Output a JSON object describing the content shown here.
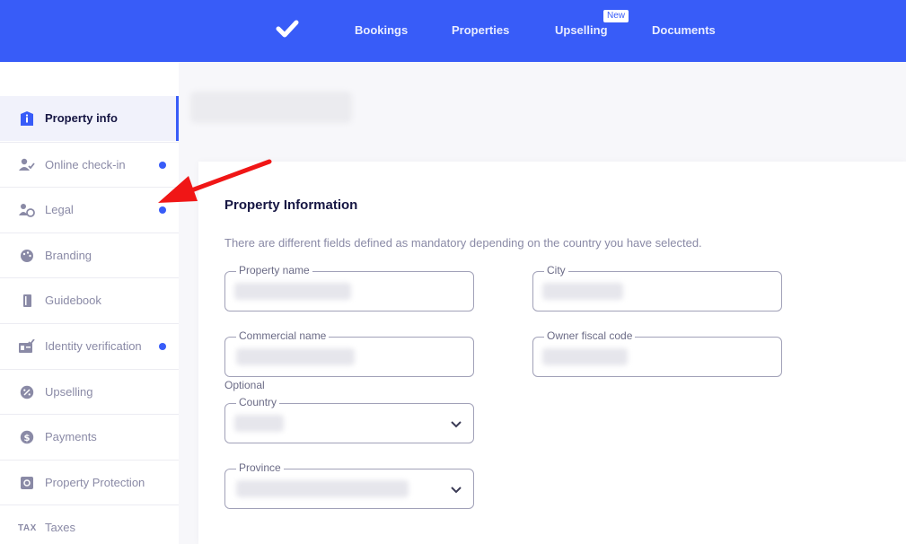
{
  "topbar": {
    "logo_icon": "checkmark-logo",
    "nav": [
      "Bookings",
      "Properties",
      "Upselling",
      "Documents"
    ],
    "new_badge": "New",
    "accent": "#385cf8"
  },
  "sidebar": {
    "items": [
      {
        "label": "Property info",
        "icon": "info-icon",
        "active": true,
        "dot": false
      },
      {
        "label": "Online check-in",
        "icon": "user-check-icon",
        "active": false,
        "dot": true
      },
      {
        "label": "Legal",
        "icon": "legal-icon",
        "active": false,
        "dot": true
      },
      {
        "label": "Branding",
        "icon": "palette-icon",
        "active": false,
        "dot": false
      },
      {
        "label": "Guidebook",
        "icon": "book-icon",
        "active": false,
        "dot": false
      },
      {
        "label": "Identity verification",
        "icon": "id-card-icon",
        "active": false,
        "dot": true
      },
      {
        "label": "Upselling",
        "icon": "percent-badge-icon",
        "active": false,
        "dot": false
      },
      {
        "label": "Payments",
        "icon": "dollar-icon",
        "active": false,
        "dot": false
      },
      {
        "label": "Property Protection",
        "icon": "safe-icon",
        "active": false,
        "dot": false
      },
      {
        "label": "Taxes",
        "icon": "TAX",
        "active": false,
        "dot": false
      }
    ]
  },
  "main": {
    "card_title": "Property Information",
    "description": "There are different fields defined as mandatory depending on the country you have selected.",
    "fields": {
      "property_name": "Property name",
      "city": "City",
      "commercial_name": "Commercial name",
      "owner_fiscal_code": "Owner fiscal code",
      "optional": "Optional",
      "country": "Country",
      "province": "Province"
    }
  },
  "annotation": {
    "arrow_color": "#f01616"
  }
}
